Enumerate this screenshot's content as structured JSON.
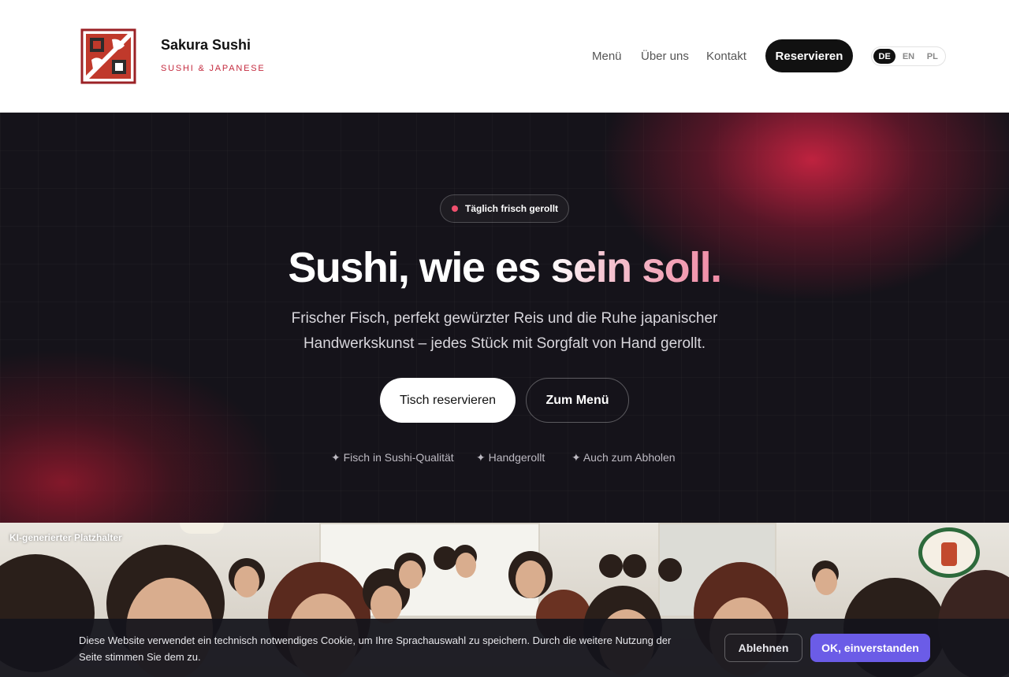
{
  "header": {
    "brand_name": "Sakura Sushi",
    "brand_tagline": "SUSHI & JAPANESE",
    "nav": [
      {
        "label": "Menü"
      },
      {
        "label": "Über uns"
      },
      {
        "label": "Kontakt"
      }
    ],
    "reserve_label": "Reservieren",
    "languages": [
      {
        "code": "DE",
        "active": true
      },
      {
        "code": "EN",
        "active": false
      },
      {
        "code": "PL",
        "active": false
      }
    ]
  },
  "hero": {
    "badge": "Täglich frisch gerollt",
    "headline_plain": "Sushi, wie es ",
    "headline_highlight": "sein soll.",
    "subtitle_line1": "Frischer Fisch, perfekt gewürzter Reis und die Ruhe japanischer",
    "subtitle_line2": "Handwerkskunst – jedes Stück mit Sorgfalt von Hand gerollt.",
    "primary_button": "Tisch reservieren",
    "secondary_button": "Zum Menü",
    "features": [
      "✦ Fisch in Sushi-Qualität",
      "✦ Handgerollt",
      "✦ Auch zum Abholen"
    ],
    "colors": {
      "accent": "#c42a3e",
      "dot": "#f0506e",
      "background": "#15131a"
    }
  },
  "photo": {
    "label": "KI-generierter Platzhalter"
  },
  "cookie": {
    "text_line1": "Diese Website verwendet ein technisch notwendiges Cookie, um Ihre Sprachauswahl zu speichern. Durch die weitere Nutzung der",
    "text_line2": "Seite stimmen Sie dem zu.",
    "decline": "Ablehnen",
    "accept": "OK, einverstanden",
    "accept_color": "#6b5ce7"
  }
}
